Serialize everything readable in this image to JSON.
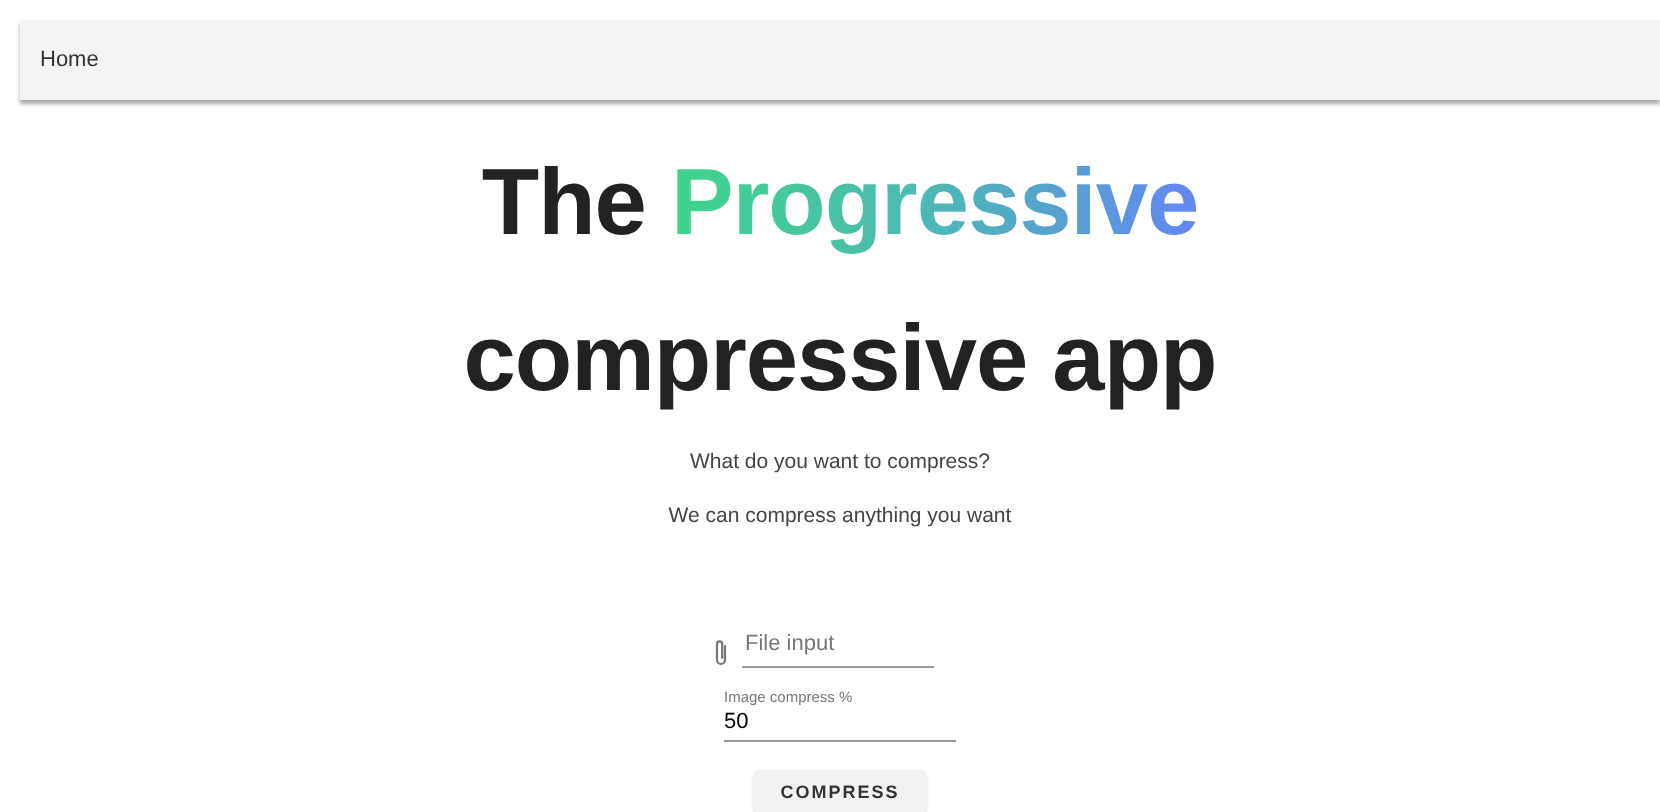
{
  "nav": {
    "home": "Home"
  },
  "hero": {
    "lead": "The",
    "highlight": "Progressive",
    "rest": "compressive app"
  },
  "intro": [
    "What do you want to compress?",
    "We can compress anything you want"
  ],
  "file_input": {
    "placeholder": "File input"
  },
  "compress_field": {
    "label": "Image compress %",
    "value": "50"
  },
  "button": "COMPRESS"
}
